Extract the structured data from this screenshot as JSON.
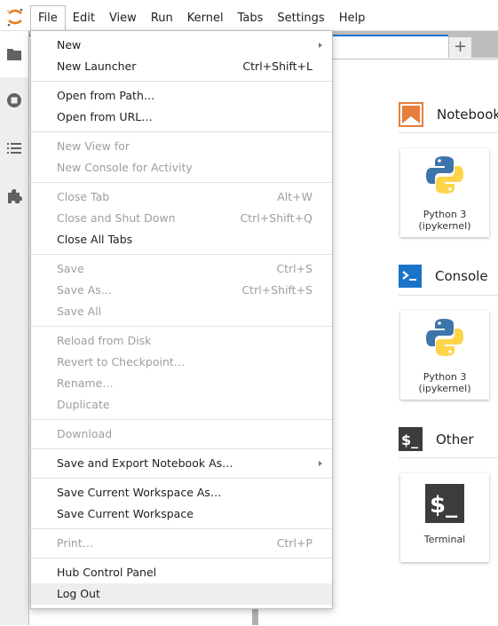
{
  "menubar": {
    "items": [
      "File",
      "Edit",
      "View",
      "Run",
      "Kernel",
      "Tabs",
      "Settings",
      "Help"
    ],
    "active": "File"
  },
  "left_sidebar": {
    "icons": [
      "folder-icon",
      "running-stop-icon",
      "table-of-contents-icon",
      "extension-puzzle-icon"
    ]
  },
  "tabbar": {
    "add_label": "+"
  },
  "file_menu": {
    "groups": [
      [
        {
          "label": "New",
          "shortcut": "",
          "disabled": false,
          "submenu": true
        },
        {
          "label": "New Launcher",
          "shortcut": "Ctrl+Shift+L",
          "disabled": false,
          "submenu": false
        }
      ],
      [
        {
          "label": "Open from Path…",
          "shortcut": "",
          "disabled": false,
          "submenu": false
        },
        {
          "label": "Open from URL…",
          "shortcut": "",
          "disabled": false,
          "submenu": false
        }
      ],
      [
        {
          "label": "New View for",
          "shortcut": "",
          "disabled": true,
          "submenu": false
        },
        {
          "label": "New Console for Activity",
          "shortcut": "",
          "disabled": true,
          "submenu": false
        }
      ],
      [
        {
          "label": "Close Tab",
          "shortcut": "Alt+W",
          "disabled": true,
          "submenu": false
        },
        {
          "label": "Close and Shut Down",
          "shortcut": "Ctrl+Shift+Q",
          "disabled": true,
          "submenu": false
        },
        {
          "label": "Close All Tabs",
          "shortcut": "",
          "disabled": false,
          "submenu": false
        }
      ],
      [
        {
          "label": "Save",
          "shortcut": "Ctrl+S",
          "disabled": true,
          "submenu": false
        },
        {
          "label": "Save As…",
          "shortcut": "Ctrl+Shift+S",
          "disabled": true,
          "submenu": false
        },
        {
          "label": "Save All",
          "shortcut": "",
          "disabled": true,
          "submenu": false
        }
      ],
      [
        {
          "label": "Reload from Disk",
          "shortcut": "",
          "disabled": true,
          "submenu": false
        },
        {
          "label": "Revert to Checkpoint…",
          "shortcut": "",
          "disabled": true,
          "submenu": false
        },
        {
          "label": "Rename…",
          "shortcut": "",
          "disabled": true,
          "submenu": false
        },
        {
          "label": "Duplicate",
          "shortcut": "",
          "disabled": true,
          "submenu": false
        }
      ],
      [
        {
          "label": "Download",
          "shortcut": "",
          "disabled": true,
          "submenu": false
        }
      ],
      [
        {
          "label": "Save and Export Notebook As…",
          "shortcut": "",
          "disabled": false,
          "submenu": true
        }
      ],
      [
        {
          "label": "Save Current Workspace As…",
          "shortcut": "",
          "disabled": false,
          "submenu": false
        },
        {
          "label": "Save Current Workspace",
          "shortcut": "",
          "disabled": false,
          "submenu": false
        }
      ],
      [
        {
          "label": "Print…",
          "shortcut": "Ctrl+P",
          "disabled": true,
          "submenu": false
        }
      ],
      [
        {
          "label": "Hub Control Panel",
          "shortcut": "",
          "disabled": false,
          "submenu": false
        },
        {
          "label": "Log Out",
          "shortcut": "",
          "disabled": false,
          "submenu": false,
          "hovered": true
        }
      ]
    ]
  },
  "launcher": {
    "sections": [
      {
        "title": "Notebook",
        "icon": "notebook-icon",
        "card": {
          "label_line1": "Python 3",
          "label_line2": "(ipykernel)",
          "icon": "python-logo-icon"
        }
      },
      {
        "title": "Console",
        "icon": "console-icon",
        "card": {
          "label_line1": "Python 3",
          "label_line2": "(ipykernel)",
          "icon": "python-logo-icon"
        }
      },
      {
        "title": "Other",
        "icon": "terminal-icon",
        "card": {
          "label_line1": "Terminal",
          "label_line2": "",
          "icon": "terminal-icon"
        }
      }
    ]
  },
  "colors": {
    "accent": "#1976d2",
    "notebook_orange": "#e67e3c",
    "console_blue": "#1a73c8",
    "terminal_dark": "#3c3c3c"
  }
}
